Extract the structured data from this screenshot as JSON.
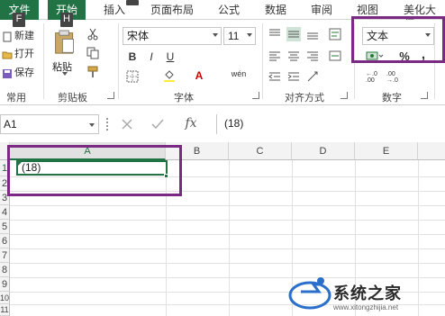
{
  "tabs": {
    "file": "文件",
    "home": "开始",
    "insert": "插入",
    "page_layout": "页面布局",
    "formulas": "公式",
    "data": "数据",
    "review": "审阅",
    "view": "视图",
    "beautify": "美化大师"
  },
  "keytips": {
    "file": "F",
    "home": "H"
  },
  "ribbon": {
    "common": {
      "new": "新建",
      "open": "打开",
      "save": "保存",
      "group": "常用"
    },
    "clipboard": {
      "paste": "粘贴",
      "group": "剪贴板"
    },
    "font": {
      "name": "宋体",
      "size": "11",
      "group": "字体",
      "font_color_letter": "A",
      "wen_label": "wén"
    },
    "alignment": {
      "group": "对齐方式"
    },
    "number": {
      "format": "文本",
      "percent": "%",
      "comma": ",",
      "group": "数字",
      "dec_inc": "←.0 .00",
      "dec_dec": ".00 →.0"
    }
  },
  "formula_bar": {
    "name_box": "A1",
    "fx": "fx",
    "content": "(18)"
  },
  "grid": {
    "columns": [
      "A",
      "B",
      "C",
      "D",
      "E"
    ],
    "rows": [
      "1",
      "2",
      "3",
      "4",
      "5",
      "6",
      "7",
      "8",
      "9",
      "10",
      "11",
      "12"
    ],
    "a1_value": "(18)"
  },
  "colors": {
    "accent": "#217346",
    "highlight": "#7a2a82"
  },
  "watermark": {
    "text": "系统之家",
    "url": "www.xitongzhijia.net"
  }
}
